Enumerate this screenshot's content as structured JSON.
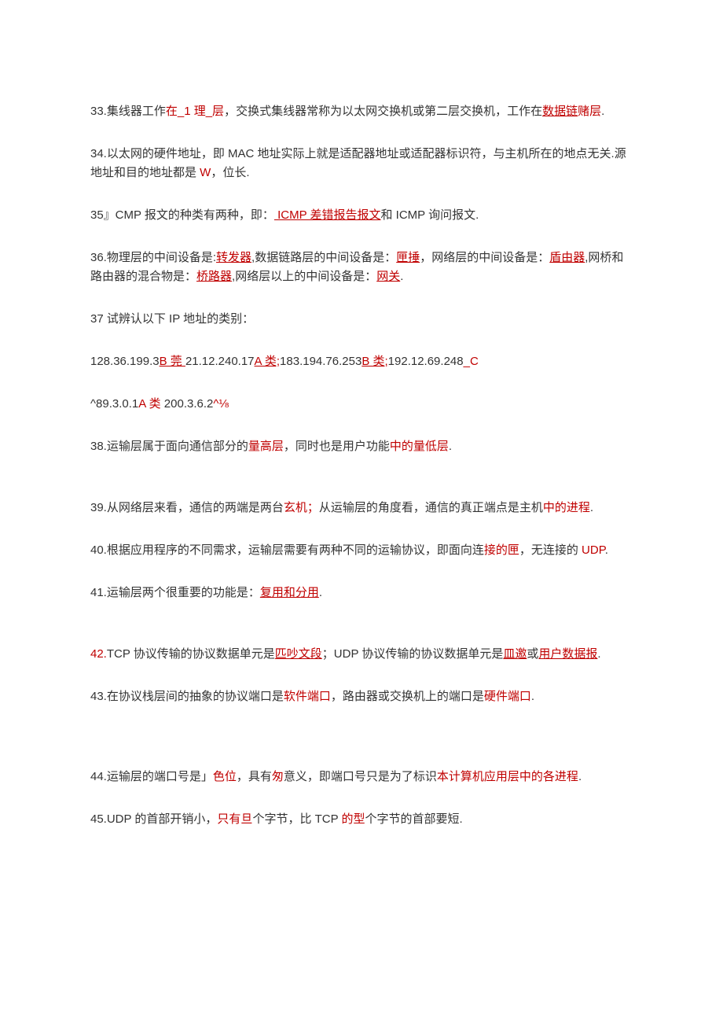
{
  "q33": {
    "t1": "33.集线器工作",
    "a1": "在_1 理_层",
    "t2": "，交换式集线器常称为以太网交换机或第二层交换机，工作在",
    "a2": "数据链",
    "a3": "赌层",
    "t3": "."
  },
  "q34": {
    "t1": "34.以太网的硬件地址，即 MAC 地址实际上就是适配器地址或适配器标识符，与主机所在的地点无关.源地址和目的地址都是 ",
    "a1": "W",
    "t2": "，位长."
  },
  "q35": {
    "t1": "35』CMP 报文的种类有两种，即：",
    "a1": " ICMP 差错报告报文",
    "t2": "和 ICMP 询问报文."
  },
  "q36": {
    "t1": "36.物理层的中间设备是:",
    "a1": "转发器",
    "t2": ",数据链路层的中间设备是：",
    "a2": "匣捶",
    "t3": "，网络层的中间设备是：",
    "a3": "盾由器",
    "t4": ",网桥和路由器的混合物是：",
    "a4": "桥路器",
    "t5": ",网络层以上的中间设备是：",
    "a5": "网关",
    "t6": "."
  },
  "q37": {
    "t1": "37 试辨认以下 IP 地址的类别：",
    "t2": "128.36.199.3",
    "a1": "B 莞 ",
    "t3": "21.12.240.17",
    "a2": "A 类;",
    "t4": "183.194.76.253",
    "a3": "B 类;",
    "t5": "192.12.69.248",
    "a4": "_C",
    "t6": "^89.3.0.1",
    "a5": "A 类",
    "t7": " 200.3.6.2",
    "a6": "^⅛"
  },
  "q38": {
    "t1": "38.运输层属于面向通信部分的",
    "a1": "量高层",
    "t2": "，同时也是用户功能",
    "a2": "中的量低层",
    "t3": "."
  },
  "q39": {
    "t1": "39.从网络层来看，通信的两端是两台",
    "a1": "玄机；",
    "t2": "从运输层的角度看，通信的真正端点是主机",
    "a2": "中的进程",
    "t3": "."
  },
  "q40": {
    "t1": "40.根据应用程序的不同需求，运输层需要有两种不同的运输协议，即面向连",
    "a1": "接的匣",
    "t2": "，无连接的 ",
    "a2": "UDP",
    "t3": "."
  },
  "q41": {
    "t1": "41.运输层两个很重要的功能是：",
    "a1": "复用和分用",
    "t2": "."
  },
  "q42": {
    "p1": "42.",
    "t1": "TCP 协议传输的协议数据单元是",
    "a1": "匹吵文段",
    "t2": "；UDP 协议传输的协议数据单元是",
    "a2": "皿邀",
    "t3": "或",
    "a3": "用户数据报",
    "t4": "."
  },
  "q43": {
    "t1": "43.在协议栈层间的抽象的协议端口是",
    "a1": "软件端口",
    "t2": "，路由器或交换机上的端口是",
    "a2": "硬件端口",
    "t3": "."
  },
  "q44": {
    "t1": "44.运输层的端口号是」",
    "a1": "色位",
    "t2": "，具有",
    "a2": "匆",
    "t3": "意义，即端口号只是为了标识",
    "a3": "本计算机应用层中的各进程",
    "t4": "."
  },
  "q45": {
    "t1": "45.UDP 的首部开销小，",
    "a1": "只有旦",
    "t2": "个字节，比 TCP ",
    "a2": "的型",
    "t3": "个字节的首部要短."
  }
}
